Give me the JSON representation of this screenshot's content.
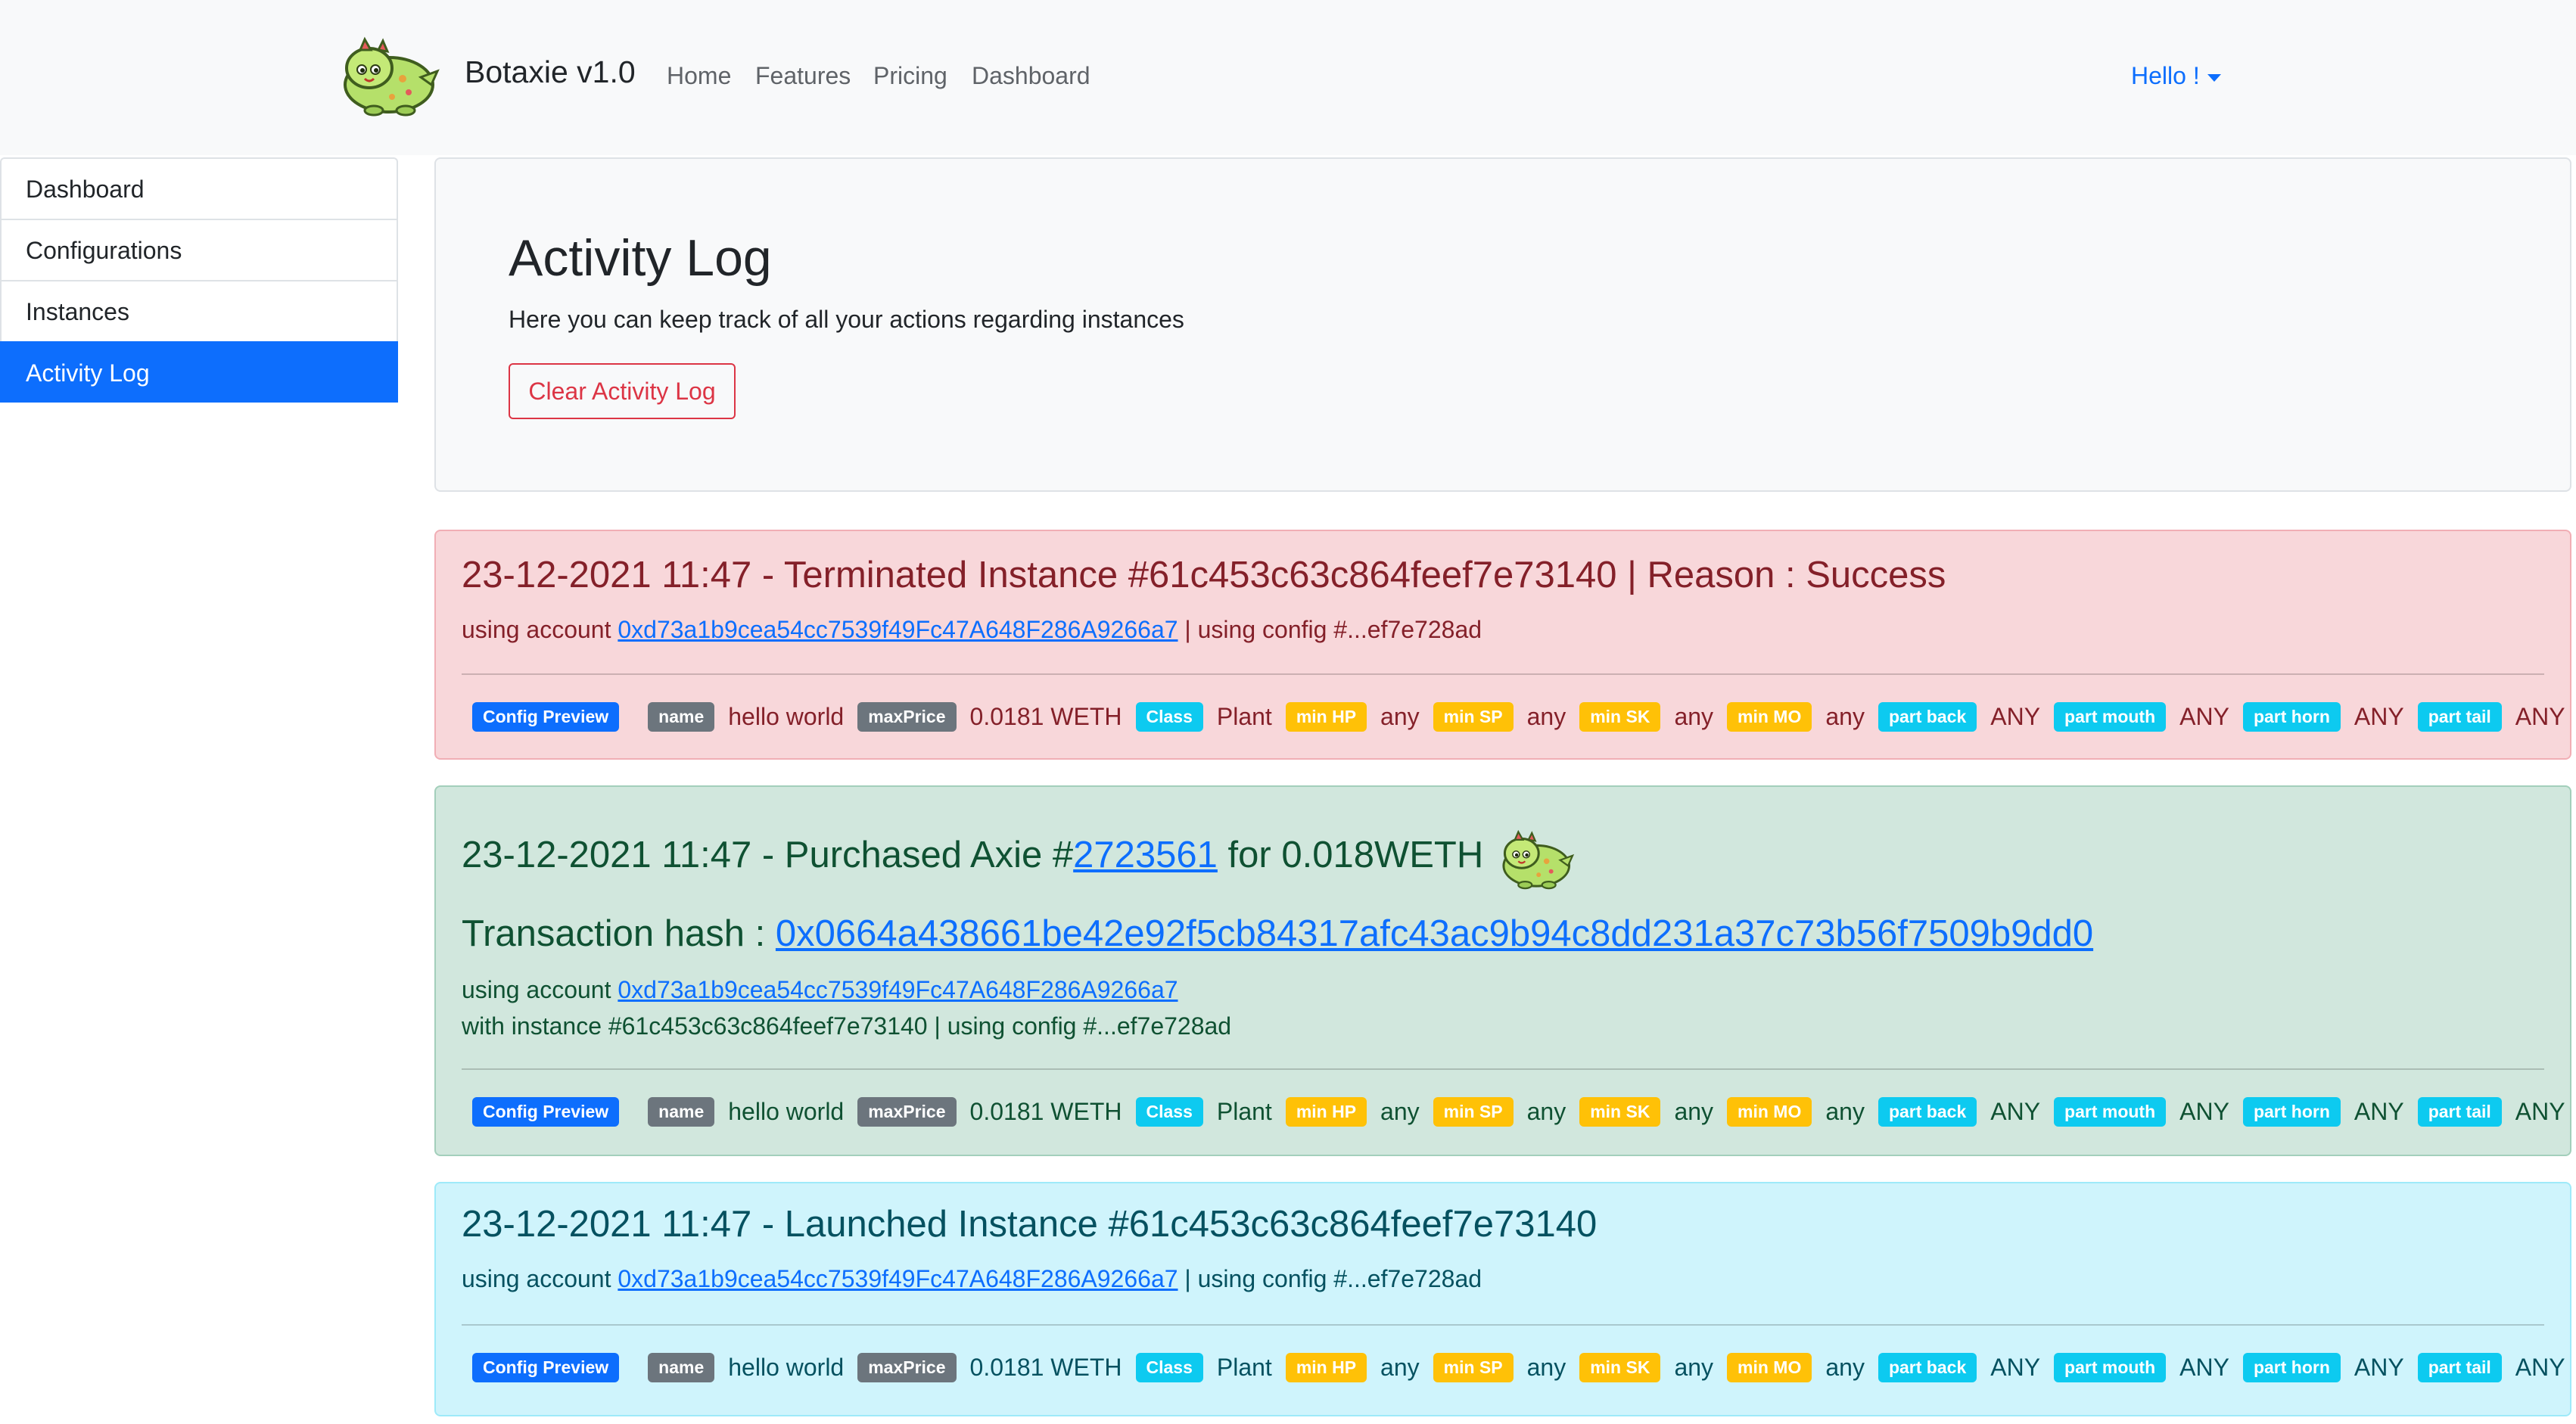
{
  "header": {
    "brand": "Botaxie v1.0",
    "nav": [
      "Home",
      "Features",
      "Pricing",
      "Dashboard"
    ],
    "user_menu": "Hello !"
  },
  "sidebar": {
    "items": [
      {
        "label": "Dashboard",
        "active": false
      },
      {
        "label": "Configurations",
        "active": false
      },
      {
        "label": "Instances",
        "active": false
      },
      {
        "label": "Activity Log",
        "active": true
      }
    ]
  },
  "page": {
    "title": "Activity Log",
    "subtitle": "Here you can keep track of all your actions regarding instances",
    "clear_button": "Clear Activity Log"
  },
  "config_preview": {
    "badge": "Config Preview",
    "fields": [
      {
        "label": "name",
        "value": "hello world",
        "kind": "secondary"
      },
      {
        "label": "maxPrice",
        "value": "0.0181 WETH",
        "kind": "secondary"
      },
      {
        "label": "Class",
        "value": "Plant",
        "kind": "info"
      },
      {
        "label": "min HP",
        "value": "any",
        "kind": "warning"
      },
      {
        "label": "min SP",
        "value": "any",
        "kind": "warning"
      },
      {
        "label": "min SK",
        "value": "any",
        "kind": "warning"
      },
      {
        "label": "min MO",
        "value": "any",
        "kind": "warning"
      },
      {
        "label": "part back",
        "value": "ANY",
        "kind": "info"
      },
      {
        "label": "part mouth",
        "value": "ANY",
        "kind": "info"
      },
      {
        "label": "part horn",
        "value": "ANY",
        "kind": "info"
      },
      {
        "label": "part tail",
        "value": "ANY",
        "kind": "info"
      }
    ]
  },
  "log": {
    "terminated": {
      "title": "23-12-2021 11:47 - Terminated Instance #61c453c63c864feef7e73140 | Reason : Success",
      "account_prefix": "using account ",
      "account": "0xd73a1b9cea54cc7539f49Fc47A648F286A9266a7",
      "config_suffix": " | using config #...ef7e728ad"
    },
    "purchased": {
      "title_prefix": "23-12-2021 11:47 - Purchased Axie #",
      "axie_id": "2723561",
      "title_suffix": " for 0.018WETH",
      "tx_prefix": "Transaction hash : ",
      "tx_hash": "0x0664a438661be42e92f5cb84317afc43ac9b94c8dd231a37c73b56f7509b9dd0",
      "account_prefix": "using account ",
      "account": "0xd73a1b9cea54cc7539f49Fc47A648F286A9266a7",
      "instance_line": "with instance #61c453c63c864feef7e73140 | using config #...ef7e728ad"
    },
    "launched": {
      "title": "23-12-2021 11:47 - Launched Instance #61c453c63c864feef7e73140",
      "account_prefix": "using account ",
      "account": "0xd73a1b9cea54cc7539f49Fc47A648F286A9266a7",
      "config_suffix": " | using config #...ef7e728ad"
    }
  }
}
